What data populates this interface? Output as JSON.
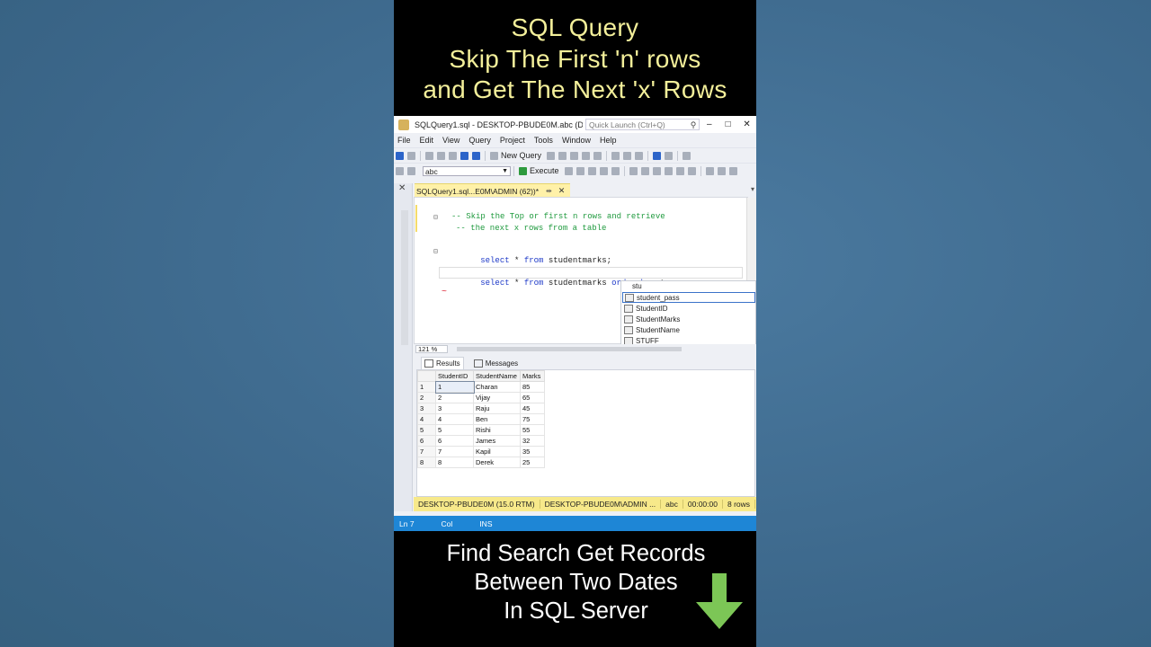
{
  "overlay": {
    "top_title_lines": [
      "SQL Query",
      "Skip The First 'n' rows",
      "and Get The Next 'x' Rows"
    ],
    "bottom_title_lines": [
      "Find Search Get Records",
      "Between Two Dates",
      "In SQL Server"
    ]
  },
  "window": {
    "title": "SQLQuery1.sql - DESKTOP-PBUDE0M.abc (DE...",
    "quick_launch_placeholder": "Quick Launch (Ctrl+Q)",
    "minimize": "–",
    "maximize": "□",
    "close": "✕"
  },
  "menu": [
    "File",
    "Edit",
    "View",
    "Query",
    "Project",
    "Tools",
    "Window",
    "Help"
  ],
  "toolbar": {
    "new_query": "New Query",
    "database": "abc",
    "execute": "Execute"
  },
  "document_tab": {
    "label": "SQLQuery1.sql...E0M\\ADMIN (62))*",
    "pin": "⇹",
    "close": "✕"
  },
  "editor": {
    "comment_line_1": "-- Skip the Top or first n rows and retrieve",
    "comment_line_2": "-- the next x rows from a table",
    "line1_kw1": "select",
    "line1_rest1": " * ",
    "line1_kw2": "from",
    "line1_rest2": " studentmarks;",
    "line2_kw1": "select",
    "line2_rest1": " * ",
    "line2_kw2": "from",
    "line2_rest2": " studentmarks ",
    "line2_kw3": "order by",
    "line2_rest3": " stu"
  },
  "autocomplete": {
    "typed": "stu",
    "items": [
      "student_pass",
      "StudentID",
      "StudentMarks",
      "StudentName",
      "STUFF"
    ]
  },
  "zoom": "121 %",
  "results_tabs": [
    "Results",
    "Messages"
  ],
  "results": {
    "columns": [
      "StudentID",
      "StudentName",
      "Marks"
    ],
    "rows": [
      [
        "1",
        "1",
        "Charan",
        "85"
      ],
      [
        "2",
        "2",
        "Vijay",
        "65"
      ],
      [
        "3",
        "3",
        "Raju",
        "45"
      ],
      [
        "4",
        "4",
        "Ben",
        "75"
      ],
      [
        "5",
        "5",
        "Rishi",
        "55"
      ],
      [
        "6",
        "6",
        "James",
        "32"
      ],
      [
        "7",
        "7",
        "Kapil",
        "35"
      ],
      [
        "8",
        "8",
        "Derek",
        "25"
      ]
    ]
  },
  "query_status": {
    "server": "DESKTOP-PBUDE0M (15.0 RTM)",
    "user": "DESKTOP-PBUDE0M\\ADMIN ...",
    "db": "abc",
    "time": "00:00:00",
    "rows": "8 rows"
  },
  "app_status": {
    "line": "Ln 7",
    "col": "Col",
    "mode": "INS"
  },
  "colors": {
    "title_yellow": "#f3ef9a",
    "arrow_green": "#7cc656",
    "status_blue": "#1e86d6",
    "query_status_yellow": "#f7e98a"
  }
}
